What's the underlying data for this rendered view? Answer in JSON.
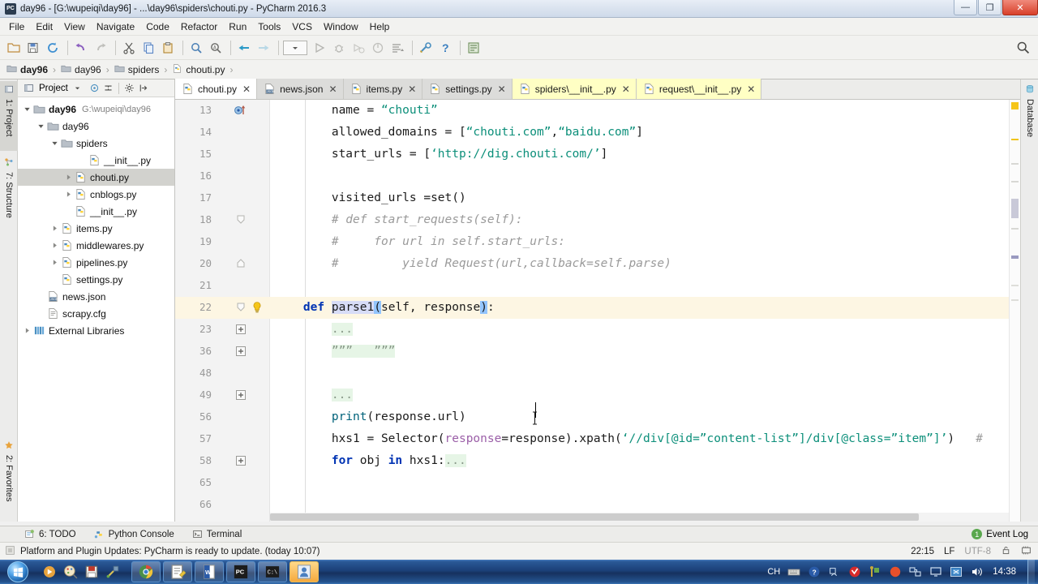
{
  "window": {
    "title": "day96 - [G:\\wupeiqi\\day96] - ...\\day96\\spiders\\chouti.py - PyCharm 2016.3",
    "app_icon": "pycharm-icon",
    "minimize": "—",
    "maximize": "❐",
    "close": "✕"
  },
  "menu": {
    "items": [
      {
        "label": "File"
      },
      {
        "label": "Edit"
      },
      {
        "label": "View"
      },
      {
        "label": "Navigate"
      },
      {
        "label": "Code"
      },
      {
        "label": "Refactor"
      },
      {
        "label": "Run"
      },
      {
        "label": "Tools"
      },
      {
        "label": "VCS"
      },
      {
        "label": "Window"
      },
      {
        "label": "Help"
      }
    ]
  },
  "toolbar": {
    "buttons": [
      {
        "name": "open-folder-icon"
      },
      {
        "name": "save-all-icon"
      },
      {
        "name": "sync-refresh-icon"
      },
      {
        "name": "undo-icon"
      },
      {
        "name": "redo-icon"
      },
      {
        "name": "cut-icon"
      },
      {
        "name": "copy-icon"
      },
      {
        "name": "paste-icon"
      },
      {
        "name": "find-icon"
      },
      {
        "name": "replace-icon"
      },
      {
        "name": "back-arrow-icon"
      },
      {
        "name": "forward-arrow-icon"
      },
      {
        "name": "run-configuration-combo"
      },
      {
        "name": "run-icon"
      },
      {
        "name": "debug-icon"
      },
      {
        "name": "run-coverage-icon"
      },
      {
        "name": "profile-icon"
      },
      {
        "name": "run-tests-icon"
      },
      {
        "name": "settings-wrench-icon"
      },
      {
        "name": "help-icon"
      },
      {
        "name": "python-console-icon"
      }
    ],
    "search_everywhere": "search-icon"
  },
  "breadcrumb": {
    "items": [
      {
        "label": "day96",
        "icon": "folder-icon",
        "bold": true
      },
      {
        "label": "day96",
        "icon": "folder-icon",
        "bold": false
      },
      {
        "label": "spiders",
        "icon": "folder-icon",
        "bold": false
      },
      {
        "label": "chouti.py",
        "icon": "python-file-icon",
        "bold": false
      }
    ],
    "separator": "›"
  },
  "left_strip": {
    "tabs": [
      {
        "label": "1: Project",
        "icon": "project-icon",
        "selected": true
      },
      {
        "label": "7: Structure",
        "icon": "structure-icon",
        "selected": false
      },
      {
        "label": "2: Favorites",
        "icon": "star-icon",
        "selected": false
      }
    ]
  },
  "right_strip": {
    "tabs": [
      {
        "label": "Database",
        "icon": "database-icon"
      }
    ]
  },
  "project_panel": {
    "title": "Project",
    "header_buttons": [
      "chevron-down-icon",
      "target-icon",
      "collapse-all-icon",
      "gear-icon",
      "hide-icon"
    ],
    "tree": [
      {
        "label": "day96",
        "path": "G:\\wupeiqi\\day96",
        "icon": "folder-icon",
        "indent": 0,
        "arrow": "down",
        "bold": true,
        "selected": false
      },
      {
        "label": "day96",
        "path": "",
        "icon": "folder-icon",
        "indent": 1,
        "arrow": "down",
        "bold": false,
        "selected": false
      },
      {
        "label": "spiders",
        "path": "",
        "icon": "folder-icon",
        "indent": 2,
        "arrow": "down",
        "bold": false,
        "selected": false
      },
      {
        "label": "__init__.py",
        "path": "",
        "icon": "python-file-icon",
        "indent": 4,
        "arrow": "none",
        "bold": false,
        "selected": false
      },
      {
        "label": "chouti.py",
        "path": "",
        "icon": "python-file-icon",
        "indent": 3,
        "arrow": "right",
        "bold": false,
        "selected": true
      },
      {
        "label": "cnblogs.py",
        "path": "",
        "icon": "python-file-icon",
        "indent": 3,
        "arrow": "right",
        "bold": false,
        "selected": false
      },
      {
        "label": "__init__.py",
        "path": "",
        "icon": "python-file-icon",
        "indent": 3,
        "arrow": "none",
        "bold": false,
        "selected": false
      },
      {
        "label": "items.py",
        "path": "",
        "icon": "python-file-icon",
        "indent": 2,
        "arrow": "right",
        "bold": false,
        "selected": false
      },
      {
        "label": "middlewares.py",
        "path": "",
        "icon": "python-file-icon",
        "indent": 2,
        "arrow": "right",
        "bold": false,
        "selected": false
      },
      {
        "label": "pipelines.py",
        "path": "",
        "icon": "python-file-icon",
        "indent": 2,
        "arrow": "right",
        "bold": false,
        "selected": false
      },
      {
        "label": "settings.py",
        "path": "",
        "icon": "python-file-icon",
        "indent": 2,
        "arrow": "none",
        "bold": false,
        "selected": false
      },
      {
        "label": "news.json",
        "path": "",
        "icon": "json-file-icon",
        "indent": 1,
        "arrow": "none",
        "bold": false,
        "selected": false
      },
      {
        "label": "scrapy.cfg",
        "path": "",
        "icon": "cfg-file-icon",
        "indent": 1,
        "arrow": "none",
        "bold": false,
        "selected": false
      },
      {
        "label": "External Libraries",
        "path": "",
        "icon": "library-icon",
        "indent": 0,
        "arrow": "right",
        "bold": false,
        "selected": false
      }
    ]
  },
  "editor_tabs": [
    {
      "label": "chouti.py",
      "icon": "python-file-icon",
      "state": "active",
      "close": "✕"
    },
    {
      "label": "news.json",
      "icon": "json-file-icon",
      "state": "normal",
      "close": "✕"
    },
    {
      "label": "items.py",
      "icon": "python-file-icon",
      "state": "normal",
      "close": "✕"
    },
    {
      "label": "settings.py",
      "icon": "python-file-icon",
      "state": "normal",
      "close": "✕"
    },
    {
      "label": "spiders\\__init__.py",
      "icon": "python-file-icon",
      "state": "highlight",
      "close": "✕"
    },
    {
      "label": "request\\__init__.py",
      "icon": "python-file-icon",
      "state": "highlight",
      "close": "✕"
    }
  ],
  "editor": {
    "file": "chouti.py",
    "lines": [
      {
        "num": "13",
        "marker": "breakpoint-override-icon",
        "bulb": false,
        "highlight": false,
        "tokens": [
          {
            "t": "        name = ",
            "c": ""
          },
          {
            "t": "“chouti”",
            "c": "str"
          }
        ]
      },
      {
        "num": "14",
        "marker": "",
        "bulb": false,
        "highlight": false,
        "tokens": [
          {
            "t": "        allowed_domains = [",
            "c": ""
          },
          {
            "t": "“chouti.com”",
            "c": "str"
          },
          {
            "t": ",",
            "c": ""
          },
          {
            "t": "“baidu.com”",
            "c": "str"
          },
          {
            "t": "]",
            "c": ""
          }
        ]
      },
      {
        "num": "15",
        "marker": "",
        "bulb": false,
        "highlight": false,
        "tokens": [
          {
            "t": "        start_urls = [",
            "c": ""
          },
          {
            "t": "‘http://dig.chouti.com/’",
            "c": "str"
          },
          {
            "t": "]",
            "c": ""
          }
        ]
      },
      {
        "num": "16",
        "marker": "",
        "bulb": false,
        "highlight": false,
        "tokens": []
      },
      {
        "num": "17",
        "marker": "",
        "bulb": false,
        "highlight": false,
        "tokens": [
          {
            "t": "        visited_urls =",
            "c": ""
          },
          {
            "t": "set",
            "c": ""
          },
          {
            "t": "()",
            "c": ""
          }
        ]
      },
      {
        "num": "18",
        "marker": "fold-end-icon",
        "bulb": false,
        "highlight": false,
        "tokens": [
          {
            "t": "        # def start_requests(self):",
            "c": "cmt"
          }
        ]
      },
      {
        "num": "19",
        "marker": "",
        "bulb": false,
        "highlight": false,
        "tokens": [
          {
            "t": "        #     for url in self.start_urls:",
            "c": "cmt"
          }
        ]
      },
      {
        "num": "20",
        "marker": "fold-start-icon",
        "bulb": false,
        "highlight": false,
        "tokens": [
          {
            "t": "        #         yield Request(url,callback=self.parse)",
            "c": "cmt"
          }
        ]
      },
      {
        "num": "21",
        "marker": "",
        "bulb": false,
        "highlight": false,
        "tokens": []
      },
      {
        "num": "22",
        "marker": "fold-end-icon",
        "bulb": true,
        "highlight": true,
        "tokens": [
          {
            "t": "    ",
            "c": ""
          },
          {
            "t": "def",
            "c": "kw"
          },
          {
            "t": " ",
            "c": ""
          },
          {
            "t": "parse1",
            "c": "sel-light"
          },
          {
            "t": "(",
            "c": "brace-hl"
          },
          {
            "t": "self, response",
            "c": ""
          },
          {
            "t": ")",
            "c": "brace-hl"
          },
          {
            "t": ":",
            "c": ""
          }
        ]
      },
      {
        "num": "23",
        "marker": "fold-plus-icon",
        "bulb": false,
        "highlight": false,
        "tokens": [
          {
            "t": "        ",
            "c": ""
          },
          {
            "t": "...",
            "c": "fold"
          }
        ]
      },
      {
        "num": "36",
        "marker": "fold-plus-icon",
        "bulb": false,
        "highlight": false,
        "tokens": [
          {
            "t": "        ",
            "c": ""
          },
          {
            "t": "”””   ”””",
            "c": "fold"
          }
        ]
      },
      {
        "num": "48",
        "marker": "",
        "bulb": false,
        "highlight": false,
        "tokens": []
      },
      {
        "num": "49",
        "marker": "fold-plus-icon",
        "bulb": false,
        "highlight": false,
        "tokens": [
          {
            "t": "        ",
            "c": ""
          },
          {
            "t": "...",
            "c": "fold"
          }
        ]
      },
      {
        "num": "56",
        "marker": "",
        "bulb": false,
        "highlight": false,
        "tokens": [
          {
            "t": "        ",
            "c": ""
          },
          {
            "t": "print",
            "c": "fn"
          },
          {
            "t": "(response.url)",
            "c": ""
          }
        ]
      },
      {
        "num": "57",
        "marker": "",
        "bulb": false,
        "highlight": false,
        "tokens": [
          {
            "t": "        hxs1 = Selector(",
            "c": ""
          },
          {
            "t": "response",
            "c": "kwarg"
          },
          {
            "t": "=response).xpath(",
            "c": ""
          },
          {
            "t": "‘//div[@id=”content-list”]/div[@class=”item”]’",
            "c": "str"
          },
          {
            "t": ")",
            "c": ""
          },
          {
            "t": "   #",
            "c": "cmt"
          }
        ]
      },
      {
        "num": "58",
        "marker": "fold-plus-icon",
        "bulb": false,
        "highlight": false,
        "tokens": [
          {
            "t": "        ",
            "c": ""
          },
          {
            "t": "for",
            "c": "kw"
          },
          {
            "t": " obj ",
            "c": ""
          },
          {
            "t": "in",
            "c": "kw"
          },
          {
            "t": " hxs1:",
            "c": ""
          },
          {
            "t": "...",
            "c": "fold"
          }
        ]
      },
      {
        "num": "65",
        "marker": "",
        "bulb": false,
        "highlight": false,
        "tokens": []
      },
      {
        "num": "66",
        "marker": "",
        "bulb": false,
        "highlight": false,
        "tokens": []
      }
    ]
  },
  "bottom_bar": {
    "items": [
      {
        "label": "6: TODO",
        "icon": "todo-icon"
      },
      {
        "label": "Python Console",
        "icon": "python-console-icon"
      },
      {
        "label": "Terminal",
        "icon": "terminal-icon"
      }
    ],
    "event_log": {
      "label": "Event Log",
      "count": "1"
    }
  },
  "status_bar": {
    "message": "Platform and Plugin Updates: PyCharm is ready to update. (today 10:07)",
    "message_icon": "info-icon",
    "position": "22:15",
    "line_separator": "LF",
    "encoding": "UTF-8",
    "lock_icon": "lock-icon",
    "memory_icon": "memory-icon"
  },
  "taskbar": {
    "start": "windows-orb-icon",
    "quick_launch": [
      {
        "name": "media-player-icon"
      },
      {
        "name": "paint-icon"
      },
      {
        "name": "save-icon"
      },
      {
        "name": "tool-icon"
      }
    ],
    "windows": [
      {
        "name": "chrome-icon",
        "active": false
      },
      {
        "name": "notepad-icon",
        "active": false
      },
      {
        "name": "word-icon",
        "active": false
      },
      {
        "name": "pycharm-icon",
        "active": false
      },
      {
        "name": "cmd-icon",
        "active": false
      },
      {
        "name": "app-icon",
        "active": true
      }
    ],
    "tray": {
      "ime": "CH",
      "icons": [
        "keyboard-icon",
        "help-blue-icon",
        "overflow-icon",
        "antivirus-icon",
        "tool-green-icon",
        "record-red-icon",
        "network-icon",
        "display-icon",
        "sync-icon",
        "volume-icon"
      ],
      "clock": "14:38"
    }
  }
}
